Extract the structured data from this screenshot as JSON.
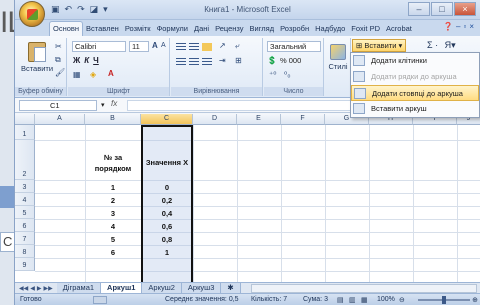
{
  "background": {
    "letters": "IL",
    "side_letter": "C"
  },
  "window": {
    "title": "Книга1 - Microsoft Excel",
    "controls": [
      "–",
      "□",
      "×"
    ]
  },
  "tabs": [
    "Основн",
    "Вставлен",
    "Розмітк",
    "Формули",
    "Дані",
    "Рецензу",
    "Вигляд",
    "Розробн",
    "Надбудо",
    "Foxit PD",
    "Acrobat"
  ],
  "ribbon": {
    "clipboard": {
      "paste_label": "Вставити",
      "group_label": "Буфер обміну"
    },
    "font": {
      "font_name": "Calibri",
      "font_size": "11",
      "bold": "Ж",
      "italic": "К",
      "underline": "Ч",
      "grow": "A",
      "shrink": "A",
      "group_label": "Шрифт"
    },
    "alignment": {
      "group_label": "Вирівнювання"
    },
    "number": {
      "format": "Загальний",
      "percent": "% 000",
      "group_label": "Число"
    },
    "styles": {
      "label": "Стилі"
    },
    "cells": {
      "insert_label": "Вставити"
    },
    "editing": {
      "sigma": "Σ ·",
      "sort": "Я▾"
    }
  },
  "insert_menu": [
    {
      "label": "Додати клітинки",
      "state": "normal"
    },
    {
      "label": "Додати рядки до аркуша",
      "state": "disabled"
    },
    {
      "label": "Додати стовпці до аркуша",
      "state": "hover"
    },
    {
      "label": "Вставити аркуш",
      "state": "normal"
    }
  ],
  "formula_bar": {
    "name_box": "C1",
    "fx": "fx",
    "value": ""
  },
  "grid": {
    "columns": [
      "A",
      "B",
      "C",
      "D",
      "E",
      "F",
      "G",
      "H",
      "I",
      "J"
    ],
    "rows": [
      "1",
      "2",
      "3",
      "4",
      "5",
      "6",
      "7",
      "8",
      "9"
    ],
    "header_b": "№ за порядком",
    "header_c": "Значення X",
    "b_values": [
      "1",
      "2",
      "3",
      "4",
      "5",
      "6"
    ],
    "c_values": [
      "0",
      "0,2",
      "0,4",
      "0,6",
      "0,8",
      "1"
    ]
  },
  "sheets": [
    "Діграма1",
    "Аркуш1",
    "Аркуш2",
    "Аркуш3"
  ],
  "status": {
    "ready": "Готово",
    "average": "Середнє значення: 0,5",
    "count": "Кількість: 7",
    "sum": "Сума: 3",
    "zoom": "100%"
  }
}
